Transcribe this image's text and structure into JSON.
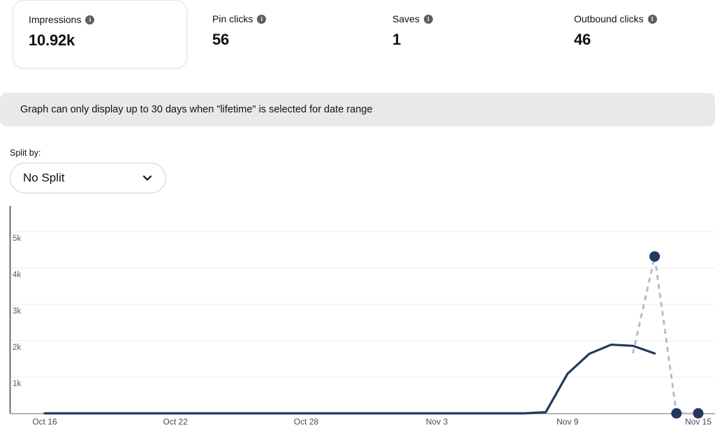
{
  "metrics": [
    {
      "label": "Impressions",
      "value": "10.92k",
      "info_icon": "info-icon",
      "highlighted": true
    },
    {
      "label": "Pin clicks",
      "value": "56",
      "info_icon": "info-icon",
      "highlighted": false
    },
    {
      "label": "Saves",
      "value": "1",
      "info_icon": "info-icon",
      "highlighted": false
    },
    {
      "label": "Outbound clicks",
      "value": "46",
      "info_icon": "info-icon",
      "highlighted": false
    }
  ],
  "notice": {
    "text": "Graph can only display up to 30 days when \"lifetime\" is selected for date range",
    "background": "#e9e9e9"
  },
  "split_by": {
    "label": "Split by:",
    "selected": "No Split",
    "options": [
      "No Split"
    ],
    "chevron_icon": "chevron-down-icon"
  },
  "colors": {
    "line": "#24385f",
    "projected_line": "#b3bcce",
    "gridline": "#ededed",
    "axis": "#6b6b6b"
  },
  "chart_data": {
    "type": "line",
    "title": "",
    "xlabel": "",
    "ylabel": "",
    "ylim": [
      0,
      5600
    ],
    "ytick_labels": [
      "1k",
      "2k",
      "3k",
      "4k",
      "5k"
    ],
    "ytick_values": [
      1000,
      2000,
      3000,
      4000,
      5000
    ],
    "xtick_labels": [
      "Oct 16",
      "Oct 22",
      "Oct 28",
      "Nov 3",
      "Nov 9",
      "Nov 15"
    ],
    "grid": true,
    "legend": "none",
    "x": [
      "Oct 16",
      "Oct 17",
      "Oct 18",
      "Oct 19",
      "Oct 20",
      "Oct 21",
      "Oct 22",
      "Oct 23",
      "Oct 24",
      "Oct 25",
      "Oct 26",
      "Oct 27",
      "Oct 28",
      "Oct 29",
      "Oct 30",
      "Oct 31",
      "Nov 1",
      "Nov 2",
      "Nov 3",
      "Nov 4",
      "Nov 5",
      "Nov 6",
      "Nov 7",
      "Nov 8",
      "Nov 9",
      "Nov 10",
      "Nov 11",
      "Nov 12",
      "Nov 13",
      "Nov 14",
      "Nov 15"
    ],
    "series": [
      {
        "name": "Impressions",
        "style": "solid",
        "values": [
          0,
          0,
          0,
          0,
          0,
          0,
          0,
          0,
          0,
          0,
          0,
          0,
          0,
          0,
          0,
          0,
          0,
          0,
          0,
          0,
          0,
          0,
          0,
          30,
          1090,
          1640,
          1890,
          1860,
          1650,
          null,
          null
        ]
      },
      {
        "name": "Impressions (projected)",
        "style": "dashed",
        "markers": true,
        "values": [
          null,
          null,
          null,
          null,
          null,
          null,
          null,
          null,
          null,
          null,
          null,
          null,
          null,
          null,
          null,
          null,
          null,
          null,
          null,
          null,
          null,
          null,
          null,
          null,
          null,
          null,
          null,
          1650,
          4320,
          0,
          0
        ]
      }
    ],
    "marker_points": [
      {
        "x": "Nov 13",
        "y": 4320
      },
      {
        "x": "Nov 14",
        "y": 0
      },
      {
        "x": "Nov 15",
        "y": 0
      }
    ]
  }
}
